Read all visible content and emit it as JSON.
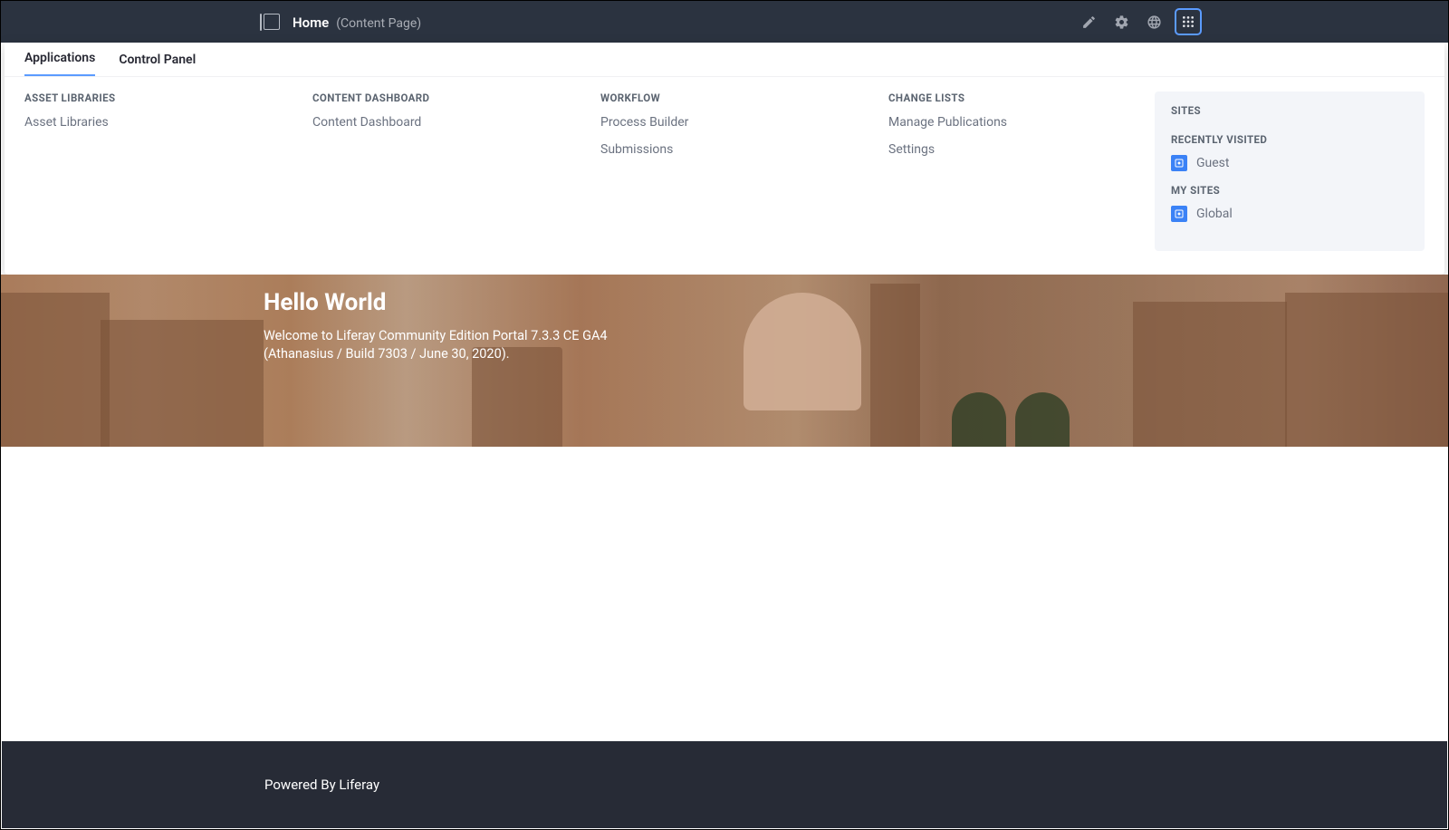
{
  "header": {
    "title": "Home",
    "subtitle": "(Content Page)"
  },
  "tabs": {
    "applications": "Applications",
    "control_panel": "Control Panel"
  },
  "columns": {
    "asset_libraries": {
      "heading": "ASSET LIBRARIES",
      "items": [
        "Asset Libraries"
      ]
    },
    "content_dashboard": {
      "heading": "CONTENT DASHBOARD",
      "items": [
        "Content Dashboard"
      ]
    },
    "workflow": {
      "heading": "WORKFLOW",
      "items": [
        "Process Builder",
        "Submissions"
      ]
    },
    "change_lists": {
      "heading": "CHANGE LISTS",
      "items": [
        "Manage Publications",
        "Settings"
      ]
    }
  },
  "sites": {
    "heading": "SITES",
    "recently_heading": "RECENTLY VISITED",
    "recently": [
      "Guest"
    ],
    "my_sites_heading": "MY SITES",
    "my_sites": [
      "Global"
    ]
  },
  "hero": {
    "title": "Hello World",
    "line1": "Welcome to Liferay Community Edition Portal 7.3.3 CE GA4",
    "line2": "(Athanasius / Build 7303 / June 30, 2020)."
  },
  "footer": {
    "text": "Powered By Liferay"
  }
}
